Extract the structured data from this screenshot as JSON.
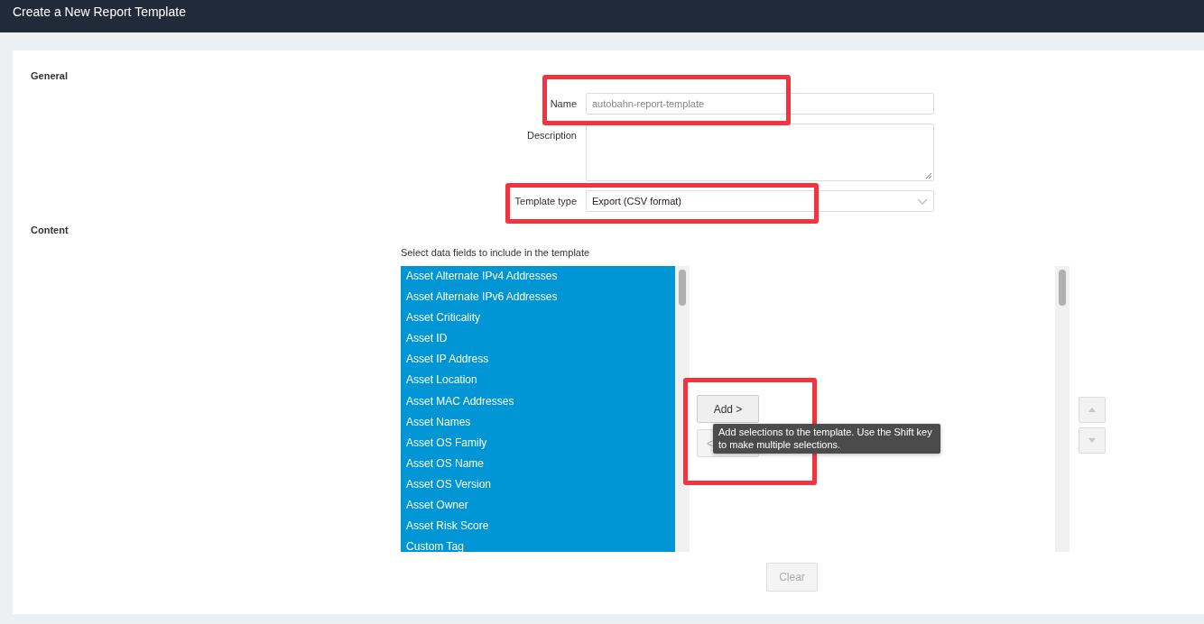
{
  "window": {
    "title": "Create a New Report Template"
  },
  "general": {
    "heading": "General",
    "fields": [
      {
        "kind": "text",
        "label": "Name",
        "value": "autobahn-report-template"
      },
      {
        "kind": "textarea",
        "label": "Description"
      },
      {
        "kind": "select",
        "label": "Template type",
        "value": "Export (CSV format)"
      }
    ]
  },
  "content": {
    "heading": "Content",
    "prompt": "Select data fields to include in the template",
    "available_fields": [
      {
        "label": "Asset Alternate IPv4 Addresses",
        "selected": true
      },
      {
        "label": "Asset Alternate IPv6 Addresses",
        "selected": true
      },
      {
        "label": "Asset Criticality",
        "selected": true
      },
      {
        "label": "Asset ID",
        "selected": true
      },
      {
        "label": "Asset IP Address",
        "selected": true
      },
      {
        "label": "Asset Location",
        "selected": true
      },
      {
        "label": "Asset MAC Addresses",
        "selected": true
      },
      {
        "label": "Asset Names",
        "selected": true
      },
      {
        "label": "Asset OS Family",
        "selected": true
      },
      {
        "label": "Asset OS Name",
        "selected": true
      },
      {
        "label": "Asset OS Version",
        "selected": true
      },
      {
        "label": "Asset Owner",
        "selected": true
      },
      {
        "label": "Asset Risk Score",
        "selected": true
      },
      {
        "label": "Custom Tag",
        "selected": true
      }
    ],
    "add_button": {
      "label": "Add >",
      "disabled": false
    },
    "remove_button": {
      "label": "<",
      "disabled": true
    },
    "tooltip": "Add selections to the template. Use the Shift key to make multiple selections.",
    "move_up_button": {
      "disabled": true
    },
    "move_down_button": {
      "disabled": true
    },
    "clear_button": {
      "label": "Clear",
      "disabled": true
    }
  }
}
